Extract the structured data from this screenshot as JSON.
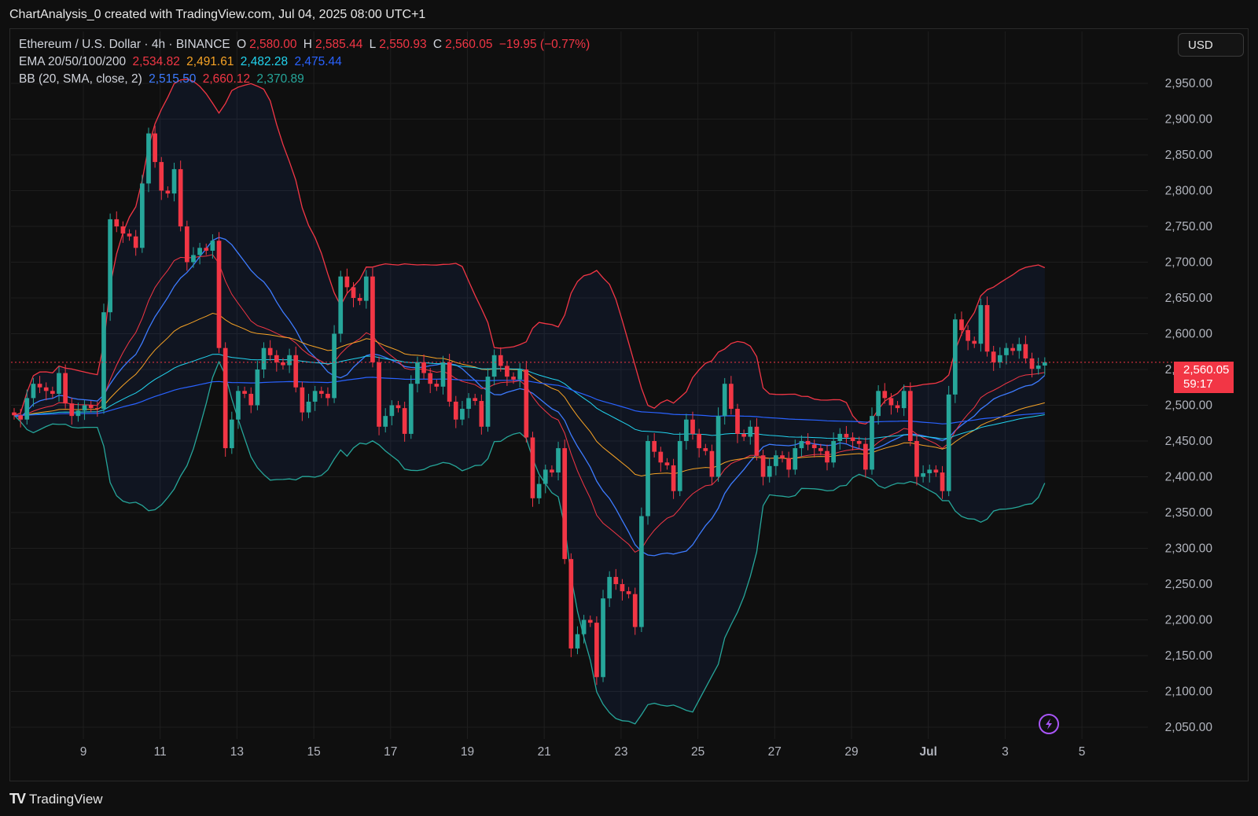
{
  "header": {
    "credit": "ChartAnalysis_0 created with TradingView.com, Jul 04, 2025 08:00 UTC+1"
  },
  "legend": {
    "symbol": "Ethereum / U.S. Dollar · 4h · BINANCE",
    "o_label": "O",
    "o_value": "2,580.00",
    "h_label": "H",
    "h_value": "2,585.44",
    "l_label": "L",
    "l_value": "2,550.93",
    "c_label": "C",
    "c_value": "2,560.05",
    "change": "−19.95 (−0.77%)",
    "ema_label": "EMA 20/50/100/200",
    "ema20": "2,534.82",
    "ema50": "2,491.61",
    "ema100": "2,482.28",
    "ema200": "2,475.44",
    "bb_label": "BB (20, SMA, close, 2)",
    "bb_basis": "2,515.50",
    "bb_upper": "2,660.12",
    "bb_lower": "2,370.89"
  },
  "currency": "USD",
  "price_tag": {
    "price": "2,560.05",
    "countdown": "59:17"
  },
  "footer": {
    "brand": "TradingView"
  },
  "colors": {
    "up": "#26a69a",
    "down": "#f23645",
    "ema20": "#f23645",
    "ema50": "#f7a325",
    "ema100": "#22d3ee",
    "ema200": "#2962ff",
    "bb_basis": "#3d7bff",
    "bb_upper": "#f23645",
    "bb_lower": "#26a69a"
  },
  "chart_data": {
    "type": "candlestick",
    "y_ticks": [
      "2,950.00",
      "2,900.00",
      "2,850.00",
      "2,800.00",
      "2,750.00",
      "2,700.00",
      "2,650.00",
      "2,600.00",
      "2,550.00",
      "2,500.00",
      "2,450.00",
      "2,400.00",
      "2,350.00",
      "2,300.00",
      "2,250.00",
      "2,200.00",
      "2,150.00",
      "2,100.00",
      "2,050.00"
    ],
    "ylim": [
      2030,
      2990
    ],
    "x_ticks": [
      "9",
      "11",
      "13",
      "15",
      "17",
      "19",
      "21",
      "23",
      "25",
      "27",
      "29",
      "Jul",
      "3",
      "5"
    ],
    "last_price": 2560.05,
    "candles_daily_ohlc": [
      {
        "day": "8",
        "o": 2490,
        "h": 2530,
        "l": 2480,
        "c": 2520
      },
      {
        "day": "9",
        "o": 2520,
        "h": 2545,
        "l": 2485,
        "c": 2500
      },
      {
        "day": "10",
        "o": 2500,
        "h": 2760,
        "l": 2495,
        "c": 2740
      },
      {
        "day": "11",
        "o": 2740,
        "h": 2880,
        "l": 2720,
        "c": 2800
      },
      {
        "day": "12",
        "o": 2800,
        "h": 2830,
        "l": 2700,
        "c": 2720
      },
      {
        "day": "13",
        "o": 2720,
        "h": 2730,
        "l": 2440,
        "c": 2520
      },
      {
        "day": "14",
        "o": 2520,
        "h": 2580,
        "l": 2500,
        "c": 2560
      },
      {
        "day": "15",
        "o": 2560,
        "h": 2570,
        "l": 2490,
        "c": 2520
      },
      {
        "day": "16",
        "o": 2520,
        "h": 2680,
        "l": 2510,
        "c": 2650
      },
      {
        "day": "17",
        "o": 2650,
        "h": 2680,
        "l": 2470,
        "c": 2500
      },
      {
        "day": "18",
        "o": 2500,
        "h": 2560,
        "l": 2460,
        "c": 2530
      },
      {
        "day": "19",
        "o": 2530,
        "h": 2560,
        "l": 2480,
        "c": 2510
      },
      {
        "day": "20",
        "o": 2510,
        "h": 2570,
        "l": 2470,
        "c": 2540
      },
      {
        "day": "21",
        "o": 2540,
        "h": 2550,
        "l": 2370,
        "c": 2410
      },
      {
        "day": "22",
        "o": 2410,
        "h": 2440,
        "l": 2160,
        "c": 2200
      },
      {
        "day": "23",
        "o": 2200,
        "h": 2260,
        "l": 2120,
        "c": 2240
      },
      {
        "day": "24",
        "o": 2240,
        "h": 2450,
        "l": 2190,
        "c": 2420
      },
      {
        "day": "25",
        "o": 2420,
        "h": 2480,
        "l": 2380,
        "c": 2440
      },
      {
        "day": "26",
        "o": 2440,
        "h": 2530,
        "l": 2400,
        "c": 2460
      },
      {
        "day": "27",
        "o": 2460,
        "h": 2470,
        "l": 2400,
        "c": 2430
      },
      {
        "day": "28",
        "o": 2430,
        "h": 2450,
        "l": 2410,
        "c": 2440
      },
      {
        "day": "29",
        "o": 2440,
        "h": 2460,
        "l": 2420,
        "c": 2450
      },
      {
        "day": "30",
        "o": 2450,
        "h": 2520,
        "l": 2410,
        "c": 2500
      },
      {
        "day": "Jul 1",
        "o": 2500,
        "h": 2520,
        "l": 2400,
        "c": 2410
      },
      {
        "day": "Jul 2",
        "o": 2410,
        "h": 2620,
        "l": 2380,
        "c": 2590
      },
      {
        "day": "Jul 3",
        "o": 2590,
        "h": 2640,
        "l": 2560,
        "c": 2580
      },
      {
        "day": "Jul 4",
        "o": 2580,
        "h": 2585.44,
        "l": 2550.93,
        "c": 2560.05
      }
    ]
  }
}
